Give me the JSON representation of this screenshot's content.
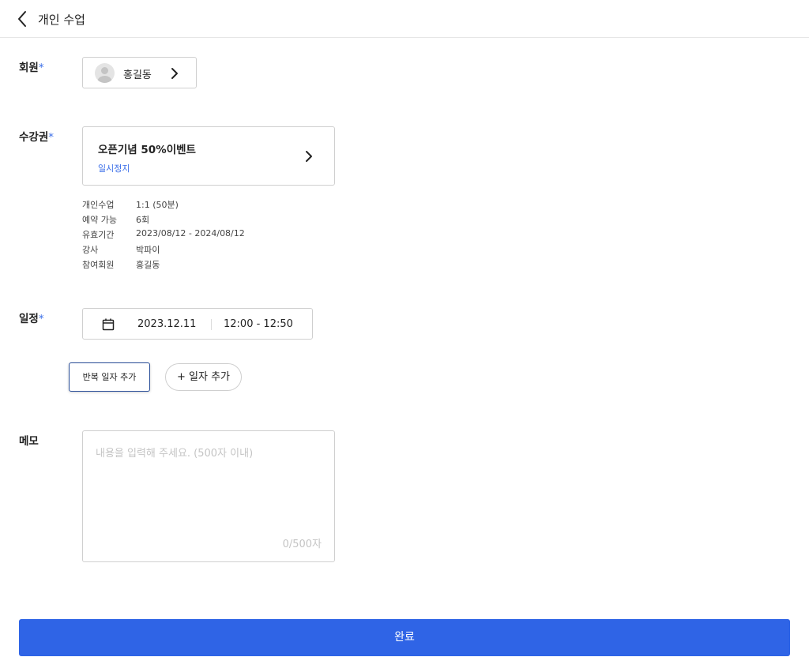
{
  "header": {
    "title": "개인 수업"
  },
  "member": {
    "label": "회원",
    "required_mark": "*",
    "name": "홍길동"
  },
  "ticket": {
    "label": "수강권",
    "required_mark": "*",
    "name": "오픈기념 50%이벤트",
    "status": "일시정지",
    "details": [
      {
        "key": "개인수업",
        "value": "1:1 (50분)"
      },
      {
        "key": "예약 가능",
        "value": "6회"
      },
      {
        "key": "유효기간",
        "value": "2023/08/12 - 2024/08/12"
      },
      {
        "key": "강사",
        "value": "박파이"
      },
      {
        "key": "참여회원",
        "value": "홍길동"
      }
    ]
  },
  "schedule": {
    "label": "일정",
    "required_mark": "*",
    "date": "2023.12.11",
    "time": "12:00 - 12:50",
    "repeat_button": "반복 일자 추가",
    "add_date_button": "+ 일자 추가"
  },
  "memo": {
    "label": "메모",
    "placeholder": "내용을 입력해 주세요. (500자 이내)",
    "value": "",
    "counter": "0/500자"
  },
  "submit": {
    "label": "완료"
  },
  "colors": {
    "accent": "#2f64e6",
    "status_blue": "#3a6ee8",
    "border": "#cfcfcf"
  }
}
